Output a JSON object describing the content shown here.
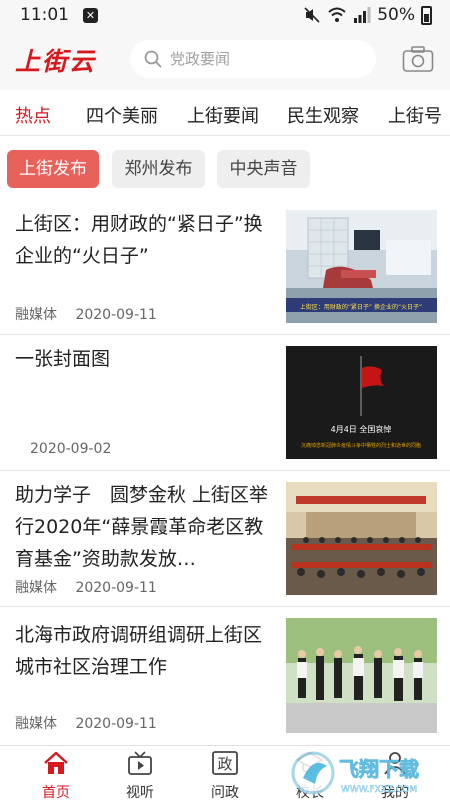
{
  "status_bar": {
    "time": "11:01",
    "battery": "50%"
  },
  "header": {
    "logo": "上街云",
    "search_placeholder": "党政要闻"
  },
  "tabs": [
    {
      "label": "热点",
      "active": true
    },
    {
      "label": "四个美丽"
    },
    {
      "label": "上街要闻"
    },
    {
      "label": "民生观察"
    },
    {
      "label": "上街号"
    }
  ],
  "subtabs": [
    {
      "label": "上街发布",
      "active": true
    },
    {
      "label": "郑州发布"
    },
    {
      "label": "中央声音"
    }
  ],
  "news": [
    {
      "title": "上街区：用财政的“紧日子”换企业的“火日子”",
      "source": "融媒体",
      "date": "2020-09-11",
      "thumb_caption": "上街区：用财政的“紧日子” 换企业的“火日子”"
    },
    {
      "title": "一张封面图",
      "source": "",
      "date": "2020-09-02",
      "thumb_caption": "4月4日  全国哀悼",
      "thumb_subcaption": "沉痛悼念新冠肺炎疫情斗争中牺牲的烈士和逝世的同胞"
    },
    {
      "title": "助力学子　圆梦金秋 上街区举行2020年“薛景霞革命老区教育基金”资助款发放…",
      "source": "融媒体",
      "date": "2020-09-11"
    },
    {
      "title": "北海市政府调研组调研上街区城市社区治理工作",
      "source": "融媒体",
      "date": "2020-09-11"
    }
  ],
  "bottom_nav": [
    {
      "label": "首页",
      "icon": "home-icon",
      "active": true
    },
    {
      "label": "视听",
      "icon": "tv-icon"
    },
    {
      "label": "问政",
      "icon": "zheng-icon",
      "glyph": "政"
    },
    {
      "label": "校长",
      "icon": "school-icon"
    },
    {
      "label": "我的",
      "icon": "user-icon"
    }
  ],
  "watermark": {
    "text": "飞翔下载",
    "url": "WWW.FXXZ.COM"
  },
  "colors": {
    "brand_red": "#d7191f",
    "chip_active": "#e8615a"
  }
}
